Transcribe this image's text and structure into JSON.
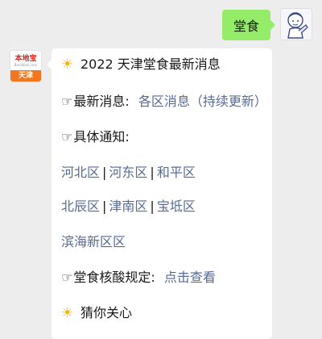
{
  "user_message": "堂食",
  "bot": {
    "logo_name": "本地宝",
    "logo_url": "Bendibao.com",
    "logo_city": "天津"
  },
  "message": {
    "title": "2022 天津堂食最新消息",
    "title_icon": "sun-icon",
    "hand_icon": "☞",
    "latest_label": "最新消息:",
    "latest_link": "各区消息（持续更新）",
    "notice_label": "具体通知:",
    "districts_row1": [
      "河北区",
      "河东区",
      "和平区"
    ],
    "districts_row2": [
      "北辰区",
      "津南区",
      "宝坻区"
    ],
    "districts_row3": [
      "滨海新区区"
    ],
    "separator": "|",
    "rule_label": "堂食核酸规定:",
    "rule_link": "点击查看",
    "guess_label": "猜你关心"
  },
  "colors": {
    "background": "#ededed",
    "user_bubble": "#95ec69",
    "link": "#576b95",
    "sun": "#f5b300",
    "logo_orange": "#f2761f"
  }
}
